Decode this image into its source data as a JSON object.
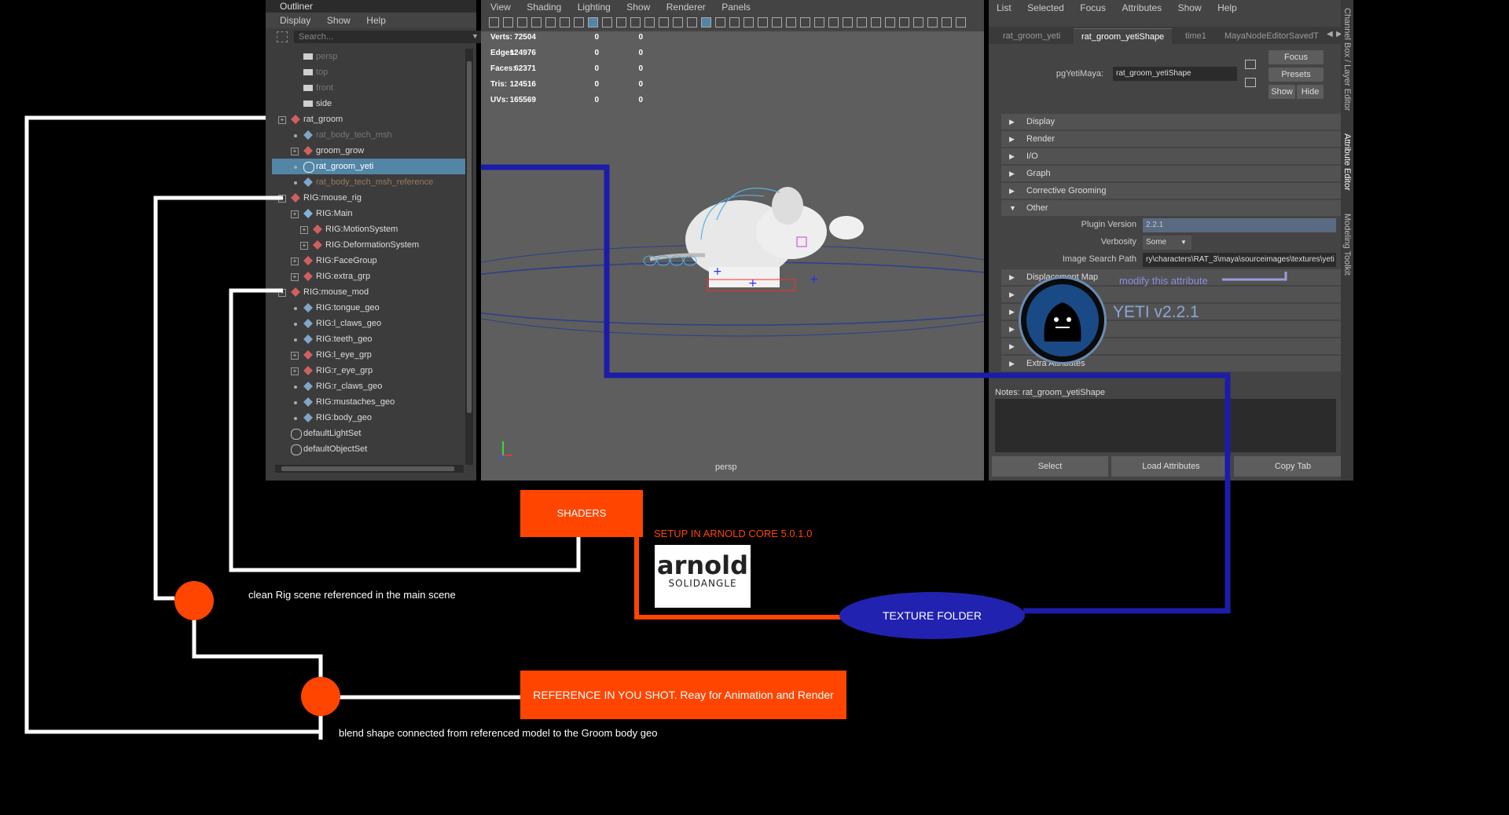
{
  "outliner": {
    "title": "Outliner",
    "menu": [
      "Display",
      "Show",
      "Help"
    ],
    "search_placeholder": "Search...",
    "items": [
      {
        "label": "persp",
        "style": "dim"
      },
      {
        "label": "top",
        "style": "dim"
      },
      {
        "label": "front",
        "style": "dim"
      },
      {
        "label": "side",
        "style": "normal"
      },
      {
        "label": "rat_groom",
        "style": "normal"
      },
      {
        "label": "rat_body_tech_msh",
        "style": "dim"
      },
      {
        "label": "groom_grow",
        "style": "normal"
      },
      {
        "label": "rat_groom_yeti",
        "style": "selected"
      },
      {
        "label": "rat_body_tech_msh_reference",
        "style": "refdim"
      },
      {
        "label": "RIG:mouse_rig",
        "style": "normal"
      },
      {
        "label": "RIG:Main",
        "style": "normal"
      },
      {
        "label": "RIG:MotionSystem",
        "style": "normal"
      },
      {
        "label": "RIG:DeformationSystem",
        "style": "normal"
      },
      {
        "label": "RIG:FaceGroup",
        "style": "normal"
      },
      {
        "label": "RIG:extra_grp",
        "style": "normal"
      },
      {
        "label": "RIG:mouse_mod",
        "style": "normal"
      },
      {
        "label": "RIG:tongue_geo",
        "style": "normal"
      },
      {
        "label": "RIG:l_claws_geo",
        "style": "normal"
      },
      {
        "label": "RIG:teeth_geo",
        "style": "normal"
      },
      {
        "label": "RIG:l_eye_grp",
        "style": "normal"
      },
      {
        "label": "RIG:r_eye_grp",
        "style": "normal"
      },
      {
        "label": "RIG:r_claws_geo",
        "style": "normal"
      },
      {
        "label": "RIG:mustaches_geo",
        "style": "normal"
      },
      {
        "label": "RIG:body_geo",
        "style": "normal"
      },
      {
        "label": "defaultLightSet",
        "style": "normal"
      },
      {
        "label": "defaultObjectSet",
        "style": "normal"
      }
    ]
  },
  "viewport": {
    "menu": [
      "View",
      "Shading",
      "Lighting",
      "Show",
      "Renderer",
      "Panels"
    ],
    "stats": [
      {
        "label": "Verts:",
        "v1": "72504",
        "v2": "0",
        "v3": "0"
      },
      {
        "label": "Edges:",
        "v1": "124976",
        "v2": "0",
        "v3": "0"
      },
      {
        "label": "Faces:",
        "v1": "62371",
        "v2": "0",
        "v3": "0"
      },
      {
        "label": "Tris:",
        "v1": "124516",
        "v2": "0",
        "v3": "0"
      },
      {
        "label": "UVs:",
        "v1": "165569",
        "v2": "0",
        "v3": "0"
      }
    ],
    "camera": "persp"
  },
  "attribute_editor": {
    "menu": [
      "List",
      "Selected",
      "Focus",
      "Attributes",
      "Show",
      "Help"
    ],
    "tabs": [
      "rat_groom_yeti",
      "rat_groom_yetiShape",
      "time1",
      "MayaNodeEditorSavedT"
    ],
    "node_type_label": "pgYetiMaya:",
    "node_name": "rat_groom_yetiShape",
    "buttons": {
      "focus": "Focus",
      "presets": "Presets",
      "show": "Show",
      "hide": "Hide"
    },
    "sections": [
      "Display",
      "Render",
      "I/O",
      "Graph",
      "Corrective Grooming",
      "Other",
      "Displacement Map",
      "",
      "",
      "",
      "",
      "Extra Attributes"
    ],
    "plugin_version_label": "Plugin Version",
    "plugin_version": "2.2.1",
    "verbosity_label": "Verbosity",
    "verbosity": "Some",
    "image_search_label": "Image Search Path",
    "image_search_path": "ry\\characters\\RAT_3\\maya\\sourceimages\\textures\\yeti",
    "notes_label": "Notes:",
    "notes_node": "rat_groom_yetiShape",
    "bottom_buttons": [
      "Select",
      "Load Attributes",
      "Copy Tab"
    ],
    "side_tabs": [
      "Channel Box / Layer Editor",
      "Attribute Editor",
      "Modeling Toolkit"
    ]
  },
  "annotations": {
    "modify_note": "modify this attribute",
    "yeti_version": "YETI v2.2.1",
    "shaders": "SHADERS",
    "arnold_setup": "SETUP IN ARNOLD CORE 5.0.1.0",
    "arnold_logo_top": "arnold",
    "arnold_logo_bottom": "SOLIDANGLE",
    "texture_folder": "TEXTURE FOLDER",
    "clean_rig": "clean Rig scene referenced in the main scene",
    "reference_shot": "REFERENCE IN YOU SHOT. Reay for Animation and Render",
    "blend_shape": "blend shape connected from referenced model to the Groom body geo"
  },
  "colors": {
    "accent_orange": "#ff4500",
    "connector_blue": "#1c1ca8",
    "selection_blue": "#5285a6"
  }
}
